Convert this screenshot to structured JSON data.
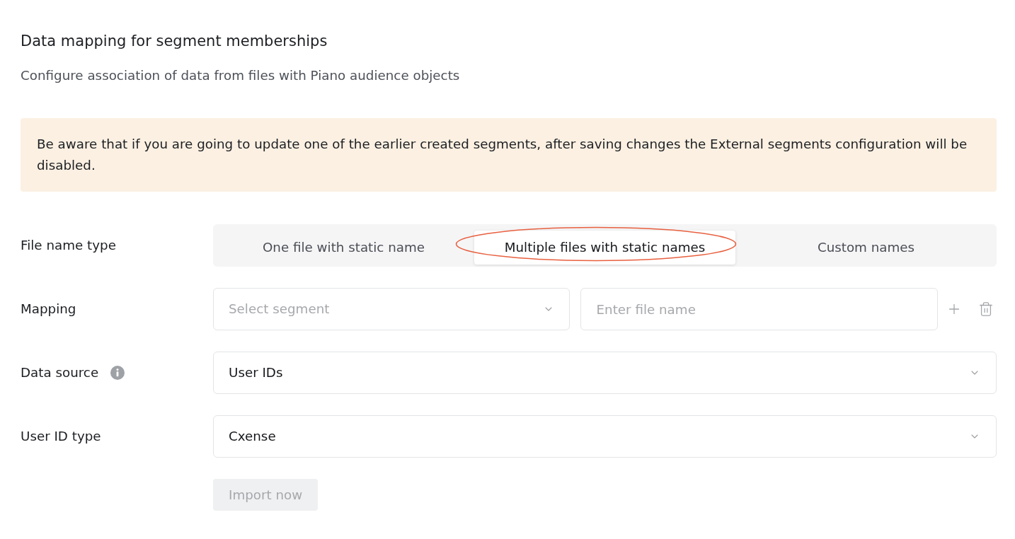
{
  "page": {
    "title": "Data mapping for segment memberships",
    "subtitle": "Configure association of data from files with Piano audience objects"
  },
  "alert": {
    "text": "Be aware that if you are going to update one of the earlier created segments, after saving changes the External segments configuration will be disabled."
  },
  "form": {
    "rows": [
      {
        "kind": "segmented",
        "label": "File name type",
        "options": [
          {
            "label": "One file with static name",
            "selected": false,
            "highlighted": false
          },
          {
            "label": "Multiple files with static names",
            "selected": true,
            "highlighted": true
          },
          {
            "label": "Custom names",
            "selected": false,
            "highlighted": false
          }
        ]
      },
      {
        "kind": "mapping",
        "label": "Mapping",
        "select": {
          "placeholder": "Select segment"
        },
        "input": {
          "placeholder": "Enter file name"
        }
      },
      {
        "kind": "select",
        "label": "Data source",
        "info": true,
        "value": "User IDs"
      },
      {
        "kind": "select",
        "label": "User ID type",
        "info": false,
        "value": "Cxense"
      }
    ]
  },
  "import_button": {
    "label": "Import now",
    "disabled": true
  }
}
